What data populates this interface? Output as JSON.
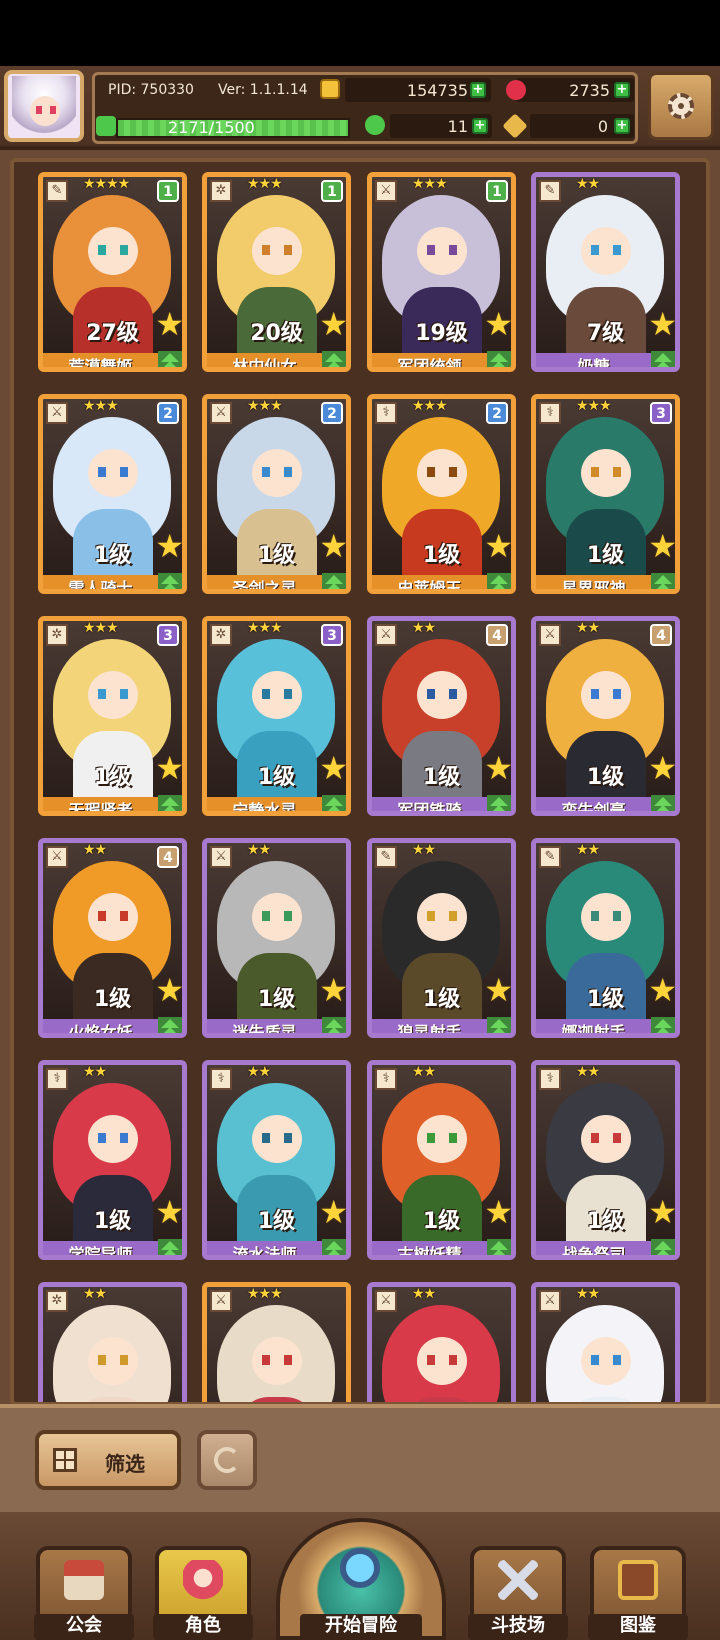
{
  "header": {
    "pid": "PID: 750330",
    "version": "Ver: 1.1.1.14",
    "gold": "154735",
    "gems": "2735",
    "energy_text": "2171/1500",
    "energy_fraction": 1.0,
    "clover": "11",
    "keys": "0"
  },
  "cards": [
    {
      "name": "荒漠舞姬",
      "level": "27级",
      "badge": "1",
      "badge_color": "green",
      "stars": "★★★★",
      "frame": "orange",
      "hair": "#e8903a",
      "body": "#b8302a",
      "eye": "#2aa8a0",
      "role": "✎"
    },
    {
      "name": "林中仙女",
      "level": "20级",
      "badge": "1",
      "badge_color": "green",
      "stars": "★★★",
      "frame": "orange",
      "hair": "#f2cc6a",
      "body": "#4a6a3a",
      "eye": "#d0802a",
      "role": "✲"
    },
    {
      "name": "军团统领",
      "level": "19级",
      "badge": "1",
      "badge_color": "green",
      "stars": "★★★",
      "frame": "orange",
      "hair": "#c8c0d8",
      "body": "#3a2a5a",
      "eye": "#7a4a9a",
      "role": "⚔"
    },
    {
      "name": "奶糖",
      "level": "7级",
      "badge": "",
      "badge_color": "",
      "stars": "★★",
      "frame": "purple",
      "hair": "#e8eef4",
      "body": "#6a4a3a",
      "eye": "#3a9ad0",
      "role": "✎"
    },
    {
      "name": "雪人骑士",
      "level": "1级",
      "badge": "2",
      "badge_color": "blue",
      "stars": "★★★",
      "frame": "orange",
      "hair": "#d8e8f8",
      "body": "#8ac0e8",
      "eye": "#3a7ad0",
      "role": "⚔"
    },
    {
      "name": "圣剑之灵",
      "level": "1级",
      "badge": "2",
      "badge_color": "blue",
      "stars": "★★★",
      "frame": "orange",
      "hair": "#c8d8e8",
      "body": "#d8c090",
      "eye": "#3a8ad0",
      "role": "⚔"
    },
    {
      "name": "史莱姆王",
      "level": "1级",
      "badge": "2",
      "badge_color": "blue",
      "stars": "★★★",
      "frame": "orange",
      "hair": "#f0a828",
      "body": "#c83a20",
      "eye": "#8a4a10",
      "role": "⚕"
    },
    {
      "name": "星界邪神",
      "level": "1级",
      "badge": "3",
      "badge_color": "violet",
      "stars": "★★★",
      "frame": "orange",
      "hair": "#2a7a6a",
      "body": "#1a4a4a",
      "eye": "#d08a2a",
      "role": "⚕"
    },
    {
      "name": "无瑕贤者",
      "level": "1级",
      "badge": "3",
      "badge_color": "violet",
      "stars": "★★★",
      "frame": "orange",
      "hair": "#f4d478",
      "body": "#f0f0f0",
      "eye": "#3a9ad0",
      "role": "✲"
    },
    {
      "name": "宁静水灵",
      "level": "1级",
      "badge": "3",
      "badge_color": "violet",
      "stars": "★★★",
      "frame": "orange",
      "hair": "#58c0d8",
      "body": "#3aa0c0",
      "eye": "#2a7aa0",
      "role": "✲"
    },
    {
      "name": "军团铁骑",
      "level": "1级",
      "badge": "4",
      "badge_color": "tan",
      "stars": "★★",
      "frame": "purple",
      "hair": "#c8402a",
      "body": "#7a7a82",
      "eye": "#2a5aa0",
      "role": "⚔"
    },
    {
      "name": "蛮牛剑豪",
      "level": "1级",
      "badge": "4",
      "badge_color": "tan",
      "stars": "★★",
      "frame": "purple",
      "hair": "#f0b040",
      "body": "#2a2a32",
      "eye": "#3a7ad0",
      "role": "⚔"
    },
    {
      "name": "火焰女妖",
      "level": "1级",
      "badge": "4",
      "badge_color": "tan",
      "stars": "★★",
      "frame": "purple",
      "hair": "#f09a28",
      "body": "#3a2a22",
      "eye": "#c83a2a",
      "role": "⚔"
    },
    {
      "name": "迷失盾灵",
      "level": "1级",
      "badge": "",
      "badge_color": "",
      "stars": "★★",
      "frame": "purple",
      "hair": "#b8b8b8",
      "body": "#4a5a2a",
      "eye": "#3a9a5a",
      "role": "⚔"
    },
    {
      "name": "狼灵射手",
      "level": "1级",
      "badge": "",
      "badge_color": "",
      "stars": "★★",
      "frame": "purple",
      "hair": "#2a2a2a",
      "body": "#5a4a2a",
      "eye": "#d0a02a",
      "role": "✎"
    },
    {
      "name": "娜迦射手",
      "level": "1级",
      "badge": "",
      "badge_color": "",
      "stars": "★★",
      "frame": "purple",
      "hair": "#2a8a7a",
      "body": "#3a6a9a",
      "eye": "#3a8a7a",
      "role": "✎"
    },
    {
      "name": "学院导师",
      "level": "1级",
      "badge": "",
      "badge_color": "",
      "stars": "★★",
      "frame": "purple",
      "hair": "#d83a4a",
      "body": "#2a2a3a",
      "eye": "#3a7ad0",
      "role": "⚕"
    },
    {
      "name": "流水法师",
      "level": "1级",
      "badge": "",
      "badge_color": "",
      "stars": "★★",
      "frame": "purple",
      "hair": "#58c0d0",
      "body": "#3a9ab0",
      "eye": "#2a6a8a",
      "role": "⚕"
    },
    {
      "name": "古树妖精",
      "level": "1级",
      "badge": "",
      "badge_color": "",
      "stars": "★★",
      "frame": "purple",
      "hair": "#e0602a",
      "body": "#3a6a2a",
      "eye": "#3a9a3a",
      "role": "⚕"
    },
    {
      "name": "战争祭司",
      "level": "1级",
      "badge": "",
      "badge_color": "",
      "stars": "★★",
      "frame": "purple",
      "hair": "#3a3a42",
      "body": "#e8e0d0",
      "eye": "#c83a3a",
      "role": "⚕"
    },
    {
      "name": "",
      "level": "",
      "badge": "",
      "badge_color": "",
      "stars": "★★",
      "frame": "purple",
      "hair": "#f0e0d0",
      "body": "#f0d8c8",
      "eye": "#d09a2a",
      "role": "✲"
    },
    {
      "name": "",
      "level": "",
      "badge": "",
      "badge_color": "",
      "stars": "★★★",
      "frame": "orange",
      "hair": "#e8dcc8",
      "body": "#c83a4a",
      "eye": "#c83a3a",
      "role": "⚔"
    },
    {
      "name": "",
      "level": "",
      "badge": "",
      "badge_color": "",
      "stars": "★★",
      "frame": "purple",
      "hair": "#d83a4a",
      "body": "#c83a4a",
      "eye": "#c83a3a",
      "role": "⚔"
    },
    {
      "name": "",
      "level": "",
      "badge": "",
      "badge_color": "",
      "stars": "★★",
      "frame": "purple",
      "hair": "#f4f4f8",
      "body": "#e8eef4",
      "eye": "#3a8ad0",
      "role": "⚔"
    }
  ],
  "filter": {
    "label": "筛选"
  },
  "nav": {
    "guild": "公会",
    "role": "角色",
    "adventure": "开始冒险",
    "arena": "斗技场",
    "codex": "图鉴"
  }
}
